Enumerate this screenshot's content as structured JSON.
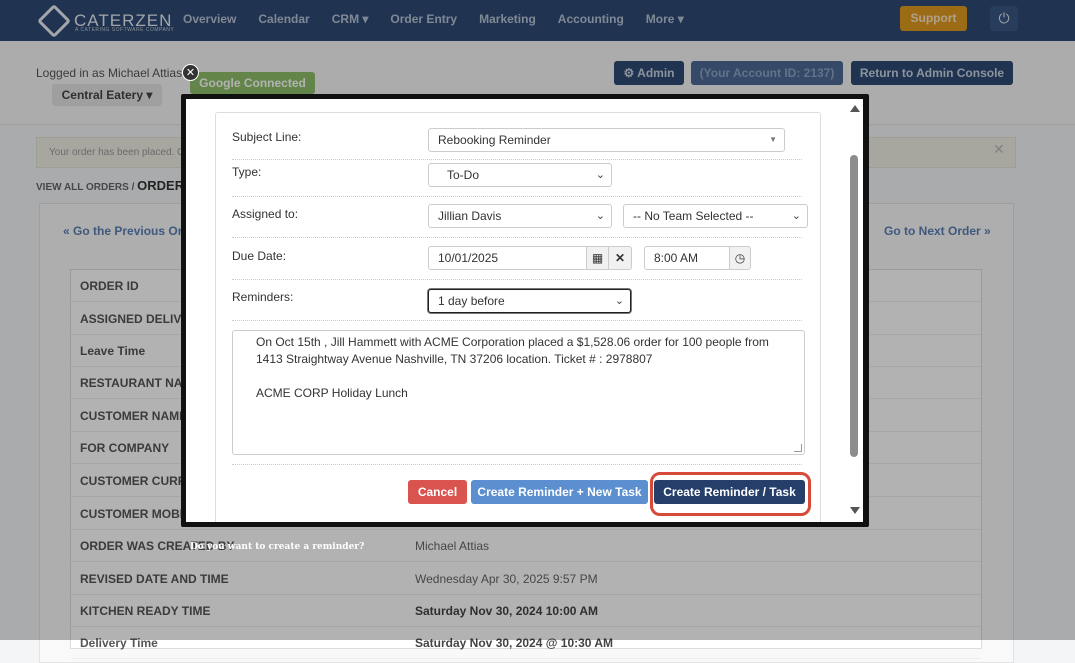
{
  "topnav": {
    "brand": "CATERZEN",
    "brand_sub": "A CATERING SOFTWARE COMPANY",
    "links": [
      "Overview",
      "Calendar",
      "CRM ▾",
      "Order Entry",
      "Marketing",
      "Accounting",
      "More ▾"
    ],
    "support": "Support"
  },
  "subheader": {
    "logged_in": "Logged in as Michael Attias",
    "location": "Central Eatery ▾",
    "google": "Google Connected",
    "admin": "⚙ Admin",
    "account_id": "(Your Account ID: 2137)",
    "return": "Return to Admin Console"
  },
  "page": {
    "alert": "Your order has been placed. G",
    "crumb_view_all": "VIEW ALL ORDERS",
    "crumb_sep": "/",
    "crumb_current": "ORDER",
    "prev": "« Go the Previous Ord",
    "next": "Go to Next Order »"
  },
  "order_rows": [
    {
      "label": "ORDER ID",
      "value": ""
    },
    {
      "label": "ASSIGNED DELIVE",
      "value": ""
    },
    {
      "label": "Leave Time",
      "value": ""
    },
    {
      "label": "RESTAURANT NA",
      "value": ""
    },
    {
      "label": "CUSTOMER NAME",
      "value": ""
    },
    {
      "label": "FOR COMPANY",
      "value": ""
    },
    {
      "label": "CUSTOMER CURR",
      "value": ""
    },
    {
      "label": "CUSTOMER MOBI",
      "value": ""
    },
    {
      "label": "ORDER WAS CREATED BY",
      "value": "Michael Attias"
    },
    {
      "label": "REVISED DATE AND TIME",
      "value": "Wednesday Apr 30, 2025 9:57 PM"
    },
    {
      "label": "KITCHEN READY TIME",
      "value": "Saturday Nov 30, 2024 10:00 AM"
    },
    {
      "label": "Delivery Time",
      "value": "Saturday Nov 30, 2024 @ 10:30 AM"
    }
  ],
  "modal": {
    "subject_label": "Subject Line:",
    "subject_value": "Rebooking Reminder",
    "type_label": "Type:",
    "type_value": "To-Do",
    "assigned_label": "Assigned to:",
    "assigned_value": "Jillian Davis",
    "team_value": "-- No Team Selected --",
    "due_label": "Due Date:",
    "due_date": "10/01/2025",
    "due_time": "8:00 AM",
    "reminders_label": "Reminders:",
    "reminders_value": "1 day before",
    "notes_line1": "On Oct 15th , Jill Hammett with ACME Corporation placed a $1,528.06 order for 100 people from",
    "notes_line2": "1413 Straightway Avenue Nashville, TN 37206 location. Ticket # : 2978807",
    "notes_line3": "ACME CORP Holiday Lunch",
    "cancel": "Cancel",
    "create_new": "Create Reminder + New Task",
    "create": "Create Reminder / Task"
  },
  "caption": "Do you want to create a reminder?",
  "icons": {
    "calendar": "calendar-icon",
    "clear": "close-icon",
    "clock": "clock-icon",
    "power": "power-icon",
    "gear": "gear-icon"
  },
  "colors": {
    "nav": "#2f4a73",
    "cancel": "#d9534f",
    "create": "#253f6a",
    "create_new": "#5b8fd0",
    "highlight": "#d64a3a",
    "support": "#e09a1f"
  }
}
